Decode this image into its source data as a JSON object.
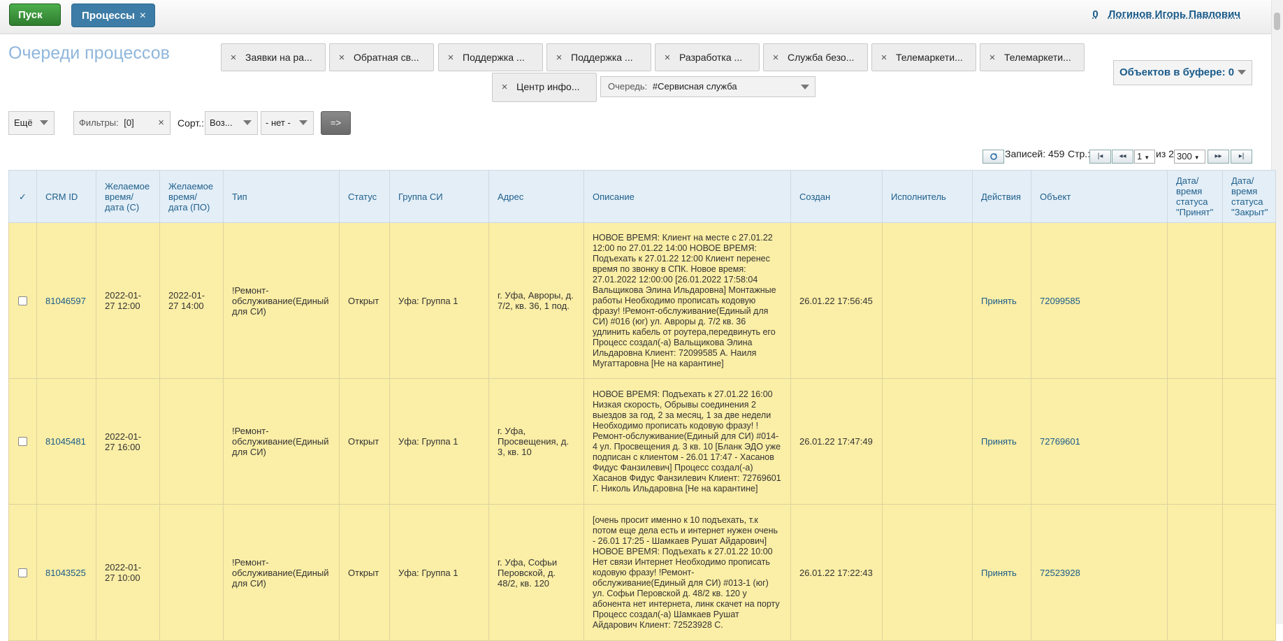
{
  "topbar": {
    "start_label": "Пуск",
    "processes_label": "Процессы",
    "close_glyph": "×",
    "user_count": "0",
    "user_name": "Логинов Игорь Павлович"
  },
  "page": {
    "title": "Очереди процессов"
  },
  "queue_tabs": [
    "Заявки на ра...",
    "Обратная св...",
    "Поддержка ...",
    "Поддержка ...",
    "Разработка ...",
    "Служба безо...",
    "Телемаркети...",
    "Телемаркети...",
    "Центр инфо..."
  ],
  "queue_select": {
    "label": "Очередь:",
    "value": "#Сервисная служба"
  },
  "buffer": {
    "label": "Объектов в буфере: 0"
  },
  "controls": {
    "more": "Ещё",
    "filters_label": "Фильтры:",
    "filters_value": "[0]",
    "sort_label": "Сорт.:",
    "sort_value": "Воз...",
    "sort2_value": "- нет -",
    "go_label": "=>"
  },
  "pager": {
    "records": "Записей: 459",
    "page_label": "Стр.:",
    "page_value": "1",
    "of_label": "из 2",
    "per_page": "300",
    "first": "|◂",
    "prev": "◂◂",
    "next": "▸▸",
    "last": "▸|",
    "refresh_icon": "refresh-icon"
  },
  "table": {
    "headers": {
      "check": "✓",
      "crm": "CRM ID",
      "from": "Желаемое время/ дата (С)",
      "to": "Желаемое время/ дата (ПО)",
      "type": "Тип",
      "status": "Статус",
      "group": "Группа СИ",
      "address": "Адрес",
      "desc": "Описание",
      "created": "Создан",
      "executor": "Исполнитель",
      "actions": "Действия",
      "object": "Объект",
      "accepted": "Дата/ время статуса \"Принят\"",
      "closed": "Дата/ время статуса \"Закрыт\""
    },
    "rows": [
      {
        "crm": "81046597",
        "from": "2022-01-27 12:00",
        "to": "2022-01-27 14:00",
        "type": "!Ремонт-обслуживание(Единый для СИ)",
        "status": "Открыт",
        "group": "Уфа: Группа 1",
        "address": "г. Уфа, Авроры, д. 7/2, кв. 36, 1 под.",
        "desc": "НОВОЕ ВРЕМЯ: Клиент на месте с 27.01.22 12:00 по 27.01.22 14:00 НОВОЕ ВРЕМЯ: Подъехать к 27.01.22 12:00 Клиент перенес время по звонку в СПК. Новое время: 27.01.2022 12:00:00 [26.01.2022 17:58:04 Вальщикова Элина Ильдаровна] Монтажные работы Необходимо прописать кодовую фразу! !Ремонт-обслуживание(Единый для СИ) #016 (юг) ул. Авроры д. 7/2 кв. 36 удлинить кабель от роутера,передвинуть его Процесс создал(-а) Вальщикова Элина Ильдаровна Клиент: 72099585 А. Наиля Мугаттаровна [Не на карантине]",
        "created": "26.01.22 17:56:45",
        "executor": "",
        "action": "Принять",
        "object": "72099585",
        "accepted": "",
        "closed": ""
      },
      {
        "crm": "81045481",
        "from": "2022-01-27 16:00",
        "to": "",
        "type": "!Ремонт-обслуживание(Единый для СИ)",
        "status": "Открыт",
        "group": "Уфа: Группа 1",
        "address": "г. Уфа, Просвещения, д. 3, кв. 10",
        "desc": "НОВОЕ ВРЕМЯ: Подъехать к 27.01.22 16:00 Низкая скорость, Обрывы соединения 2 выездов за год, 2 за месяц, 1 за две недели Необходимо прописать кодовую фразу! !Ремонт-обслуживание(Единый для СИ) #014-4 ул. Просвещения д. 3 кв. 10 [Бланк ЭДО уже подписан с клиентом - 26.01 17:47 - Хасанов Фидус Фанзилевич] Процесс создал(-а) Хасанов Фидус Фанзилевич Клиент: 72769601 Г. Николь Ильдаровна [Не на карантине]",
        "created": "26.01.22 17:47:49",
        "executor": "",
        "action": "Принять",
        "object": "72769601",
        "accepted": "",
        "closed": ""
      },
      {
        "crm": "81043525",
        "from": "2022-01-27 10:00",
        "to": "",
        "type": "!Ремонт-обслуживание(Единый для СИ)",
        "status": "Открыт",
        "group": "Уфа: Группа 1",
        "address": "г. Уфа, Софьи Перовской, д. 48/2, кв. 120",
        "desc": "[очень просит именно к 10 подъехать, т.к потом еще дела есть и интернет нужен очень - 26.01 17:25 - Шамкаев Рушат Айдарович] НОВОЕ ВРЕМЯ: Подъехать к 27.01.22 10:00 Нет связи Интернет Необходимо прописать кодовую фразу! !Ремонт-обслуживание(Единый для СИ) #013-1 (юг) ул. Софьи Перовской д. 48/2 кв. 120 у абонента нет интернета, линк скачет на порту Процесс создал(-а) Шамкаев Рушат Айдарович Клиент: 72523928 С.",
        "created": "26.01.22 17:22:43",
        "executor": "",
        "action": "Принять",
        "object": "72523928",
        "accepted": "",
        "closed": ""
      }
    ]
  }
}
